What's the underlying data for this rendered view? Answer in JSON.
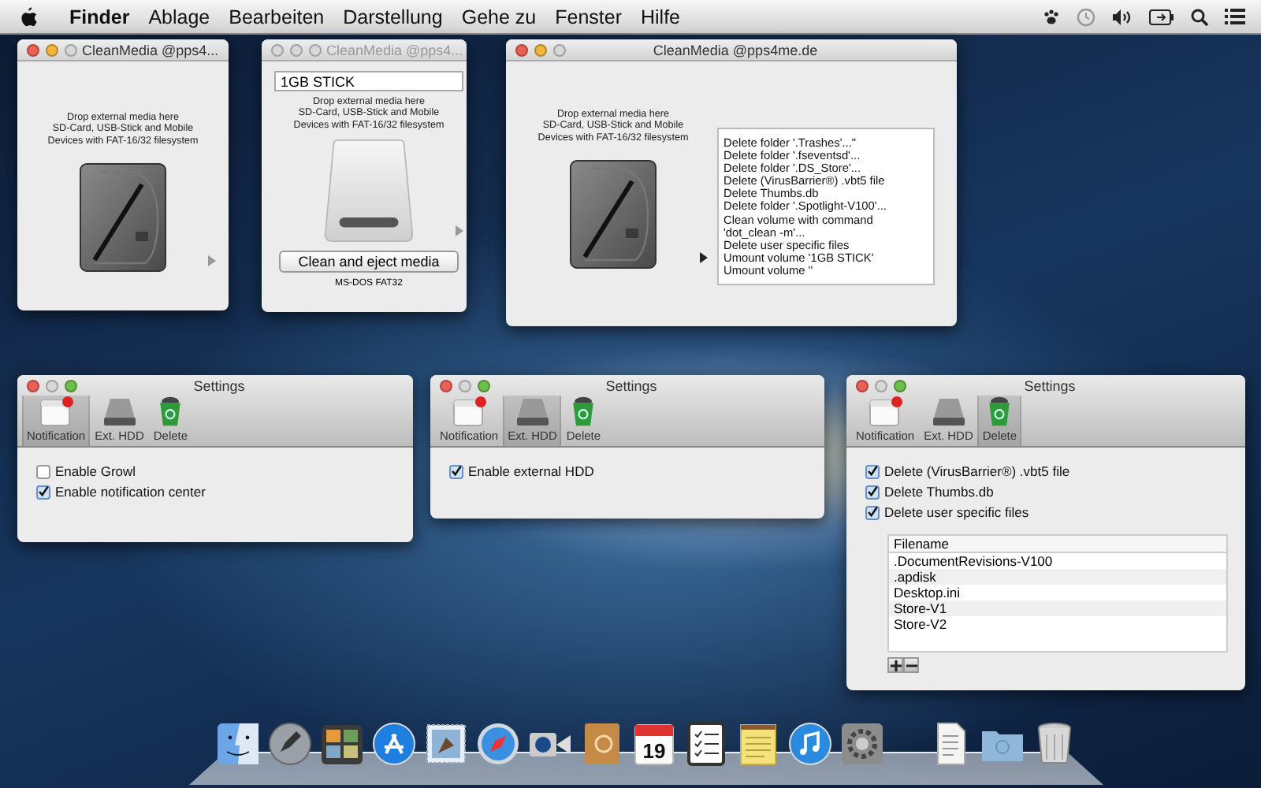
{
  "menu_bar": {
    "items": [
      {
        "label": "Finder",
        "kind": "app"
      },
      {
        "label": "Ablage",
        "kind": "menu"
      },
      {
        "label": "Bearbeiten",
        "kind": "menu"
      },
      {
        "label": "Darstellung",
        "kind": "menu"
      },
      {
        "label": "Gehe zu",
        "kind": "menu"
      },
      {
        "label": "Fenster",
        "kind": "menu"
      },
      {
        "label": "Hilfe",
        "kind": "menu"
      }
    ]
  },
  "media_windows": [
    {
      "title": "CleanMedia @pps4...",
      "active": true,
      "hint": [
        "Drop external media here",
        "SD-Card, USB-Stick and Mobile",
        "Devices with FAT-16/32 filesystem"
      ],
      "kind": "hdd"
    },
    {
      "title": "CleanMedia @pps4...",
      "active": false,
      "volume_name": "1GB STICK",
      "hint": [
        "Drop external media here",
        "SD-Card, USB-Stick and Mobile",
        "Devices with FAT-16/32 filesystem"
      ],
      "kind": "usb",
      "button": "Clean and eject media",
      "format": "MS-DOS FAT32"
    },
    {
      "title": "CleanMedia @pps4me.de",
      "active": true,
      "hint": [
        "Drop external media here",
        "SD-Card, USB-Stick and Mobile",
        "Devices with FAT-16/32 filesystem"
      ],
      "kind": "hdd",
      "log": [
        "Delete folder '.Trashes'...\"",
        "Delete folder '.fseventsd'...",
        "Delete folder '.DS_Store'...",
        "Delete (VirusBarrier®) .vbt5 file",
        "Delete Thumbs.db",
        "Delete folder '.Spotlight-V100'...",
        "Clean volume with command",
        "'dot_clean -m'...",
        "Delete user specific files",
        "Umount volume '1GB STICK'",
        "Umount volume ''"
      ]
    }
  ],
  "settings_windows": [
    {
      "title": "Settings",
      "tabs": [
        {
          "label": "Notification",
          "selected": true
        },
        {
          "label": "Ext. HDD",
          "selected": false
        },
        {
          "label": "Delete",
          "selected": false
        }
      ],
      "options": [
        {
          "label": "Enable Growl",
          "checked": false
        },
        {
          "label": "Enable notification center",
          "checked": true
        }
      ]
    },
    {
      "title": "Settings",
      "tabs": [
        {
          "label": "Notification",
          "selected": false
        },
        {
          "label": "Ext. HDD",
          "selected": true
        },
        {
          "label": "Delete",
          "selected": false
        }
      ],
      "options": [
        {
          "label": "Enable external HDD",
          "checked": true
        }
      ]
    },
    {
      "title": "Settings",
      "tabs": [
        {
          "label": "Notification",
          "selected": false
        },
        {
          "label": "Ext. HDD",
          "selected": false
        },
        {
          "label": "Delete",
          "selected": true
        }
      ],
      "options": [
        {
          "label": "Delete (VirusBarrier®) .vbt5 file",
          "checked": true
        },
        {
          "label": "Delete Thumbs.db",
          "checked": true
        },
        {
          "label": "Delete user specific files",
          "checked": true
        }
      ],
      "table": {
        "columns": [
          "Filename"
        ],
        "rows": [
          [
            ".DocumentRevisions-V100"
          ],
          [
            ".apdisk"
          ],
          [
            "Desktop.ini"
          ],
          [
            "Store-V1"
          ],
          [
            "Store-V2"
          ]
        ]
      }
    }
  ],
  "dock": {
    "calendar_day": "19"
  }
}
